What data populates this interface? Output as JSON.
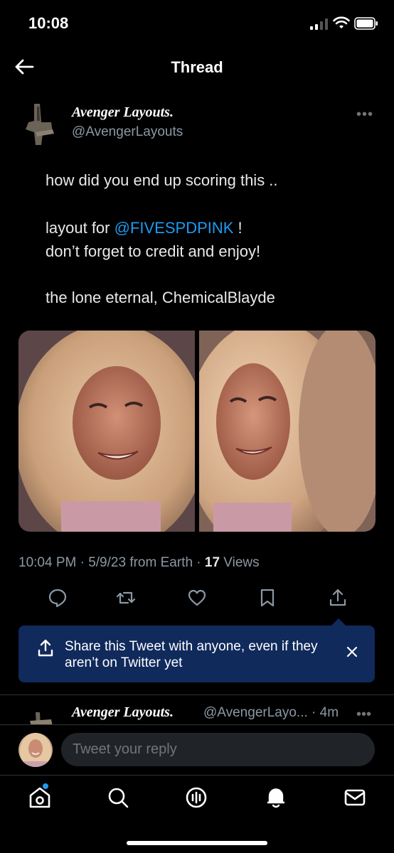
{
  "status_bar": {
    "time": "10:08"
  },
  "header": {
    "title": "Thread"
  },
  "tweet": {
    "author_name": "Avenger Layouts.",
    "handle": "@AvengerLayouts",
    "text": {
      "line1": "how did you end up scoring this ..",
      "line2_prefix": "layout for ",
      "line2_mention": "@FIVESPDPINK",
      "line2_suffix": " !",
      "line3": "don’t forget to credit and enjoy!",
      "line4": "the lone eternal, ChemicalBlayde"
    },
    "meta": {
      "timestamp": "10:04 PM · 5/9/23 from Earth · ",
      "views_count": "17",
      "views_label": " Views"
    },
    "images": [
      "photo-woman-blonde-curly-hair-smiling",
      "photo-woman-blonde-curly-hair-smiling-2"
    ]
  },
  "share_toast": {
    "text": "Share this Tweet with anyone, even if they aren’t on Twitter yet"
  },
  "reply_preview": {
    "author_name": "Avenger Layouts.",
    "handle_time": "@AvengerLayo... · 4m"
  },
  "composer": {
    "placeholder": "Tweet your reply"
  },
  "colors": {
    "accent": "#1d9bf0",
    "toast_bg": "#102a5c",
    "muted": "#8b98a5"
  },
  "icons": {
    "actions": [
      "reply-icon",
      "retweet-icon",
      "like-icon",
      "bookmark-icon",
      "share-icon"
    ],
    "tabs": [
      "home-icon",
      "search-icon",
      "spaces-icon",
      "notifications-icon",
      "messages-icon"
    ]
  }
}
